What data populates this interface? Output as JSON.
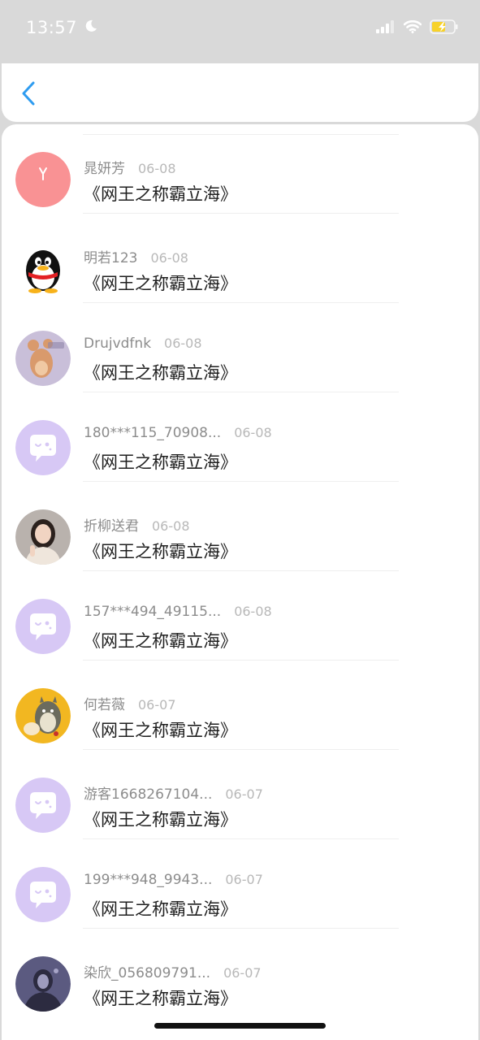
{
  "status_bar": {
    "time": "13:57",
    "icons": [
      "moon-icon",
      "signal-icon",
      "wifi-icon",
      "battery-charging-icon"
    ],
    "battery_color": "#f7d22b"
  },
  "nav": {
    "back_icon": "chevron-left-icon",
    "accent_color": "#2f9cf0"
  },
  "items": [
    {
      "user": "晁妍芳",
      "date": "06-08",
      "message": "《网王之称霸立海》",
      "avatar": "pink-photo"
    },
    {
      "user": "明若123",
      "date": "06-08",
      "message": "《网王之称霸立海》",
      "avatar": "qq-penguin"
    },
    {
      "user": "Drujvdfnk",
      "date": "06-08",
      "message": "《网王之称霸立海》",
      "avatar": "cartoon-photo"
    },
    {
      "user": "180***115_70908...",
      "date": "06-08",
      "message": "《网王之称霸立海》",
      "avatar": "default-chat"
    },
    {
      "user": "折柳送君",
      "date": "06-08",
      "message": "《网王之称霸立海》",
      "avatar": "girl-photo"
    },
    {
      "user": "157***494_49115...",
      "date": "06-08",
      "message": "《网王之称霸立海》",
      "avatar": "default-chat"
    },
    {
      "user": "何若薇",
      "date": "06-07",
      "message": "《网王之称霸立海》",
      "avatar": "totoro-photo"
    },
    {
      "user": "游客1668267104...",
      "date": "06-07",
      "message": "《网王之称霸立海》",
      "avatar": "default-chat"
    },
    {
      "user": "199***948_9943...",
      "date": "06-07",
      "message": "《网王之称霸立海》",
      "avatar": "default-chat"
    },
    {
      "user": "染欣_056809791...",
      "date": "06-07",
      "message": "《网王之称霸立海》",
      "avatar": "dark-photo"
    }
  ]
}
